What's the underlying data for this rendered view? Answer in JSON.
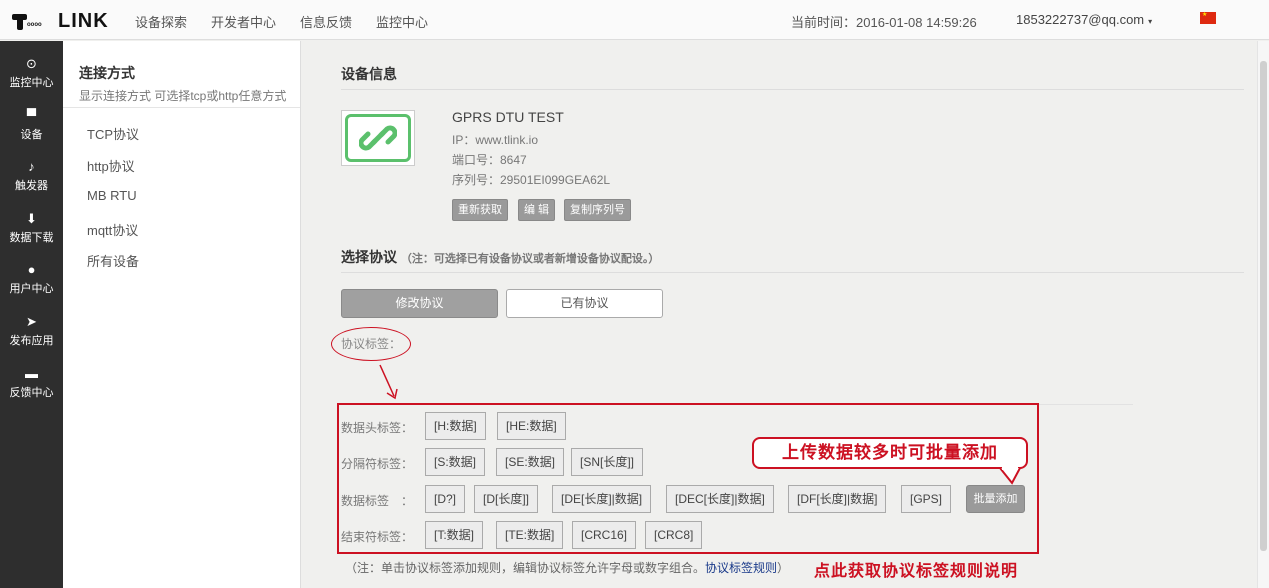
{
  "header": {
    "logo_text": "LINK",
    "logo_dots": "oooo",
    "nav": [
      "设备探索",
      "开发者中心",
      "信息反馈",
      "监控中心"
    ],
    "time_label": "当前时间：2016-01-08 14:59:26",
    "user": "1853222737@qq.com",
    "user_caret": "▾",
    "flag": "★"
  },
  "sidebar": {
    "items": [
      {
        "label": "监控中心",
        "icon": "target-icon",
        "glyph": "⊙"
      },
      {
        "label": "设备",
        "icon": "device-icon",
        "glyph": "▀"
      },
      {
        "label": "触发器",
        "icon": "bell-icon",
        "glyph": "♪"
      },
      {
        "label": "数据下载",
        "icon": "download-icon",
        "glyph": "⬇"
      },
      {
        "label": "用户中心",
        "icon": "user-icon",
        "glyph": "●"
      },
      {
        "label": "发布应用",
        "icon": "send-icon",
        "glyph": "➤"
      },
      {
        "label": "反馈中心",
        "icon": "comment-icon",
        "glyph": "▬"
      }
    ]
  },
  "panel": {
    "title": "连接方式",
    "subtitle": "显示连接方式 可选择tcp或http任意方式",
    "links": [
      "TCP协议",
      "http协议",
      "MB RTU",
      "mqtt协议",
      "所有设备"
    ]
  },
  "device": {
    "section_title": "设备信息",
    "icon": "link-icon",
    "name": "GPRS DTU TEST",
    "ip": "IP：www.tlink.io",
    "port": "端口号：8647",
    "serial": "序列号：29501EI099GEA62L",
    "buttons": [
      "重新获取",
      "编 辑",
      "复制序列号"
    ]
  },
  "protocol": {
    "section_title": "选择协议",
    "section_note": "（注：可选择已有设备协议或者新增设备协议配设。）",
    "tabs": [
      "修改协议",
      "已有协议"
    ],
    "label_tag": "协议标签：",
    "arrow": "↓",
    "rows": [
      {
        "label": "数据头标签：",
        "tags": [
          "[H:数据]",
          "[HE:数据]"
        ]
      },
      {
        "label": "分隔符标签：",
        "tags": [
          "[S:数据]",
          "[SE:数据]",
          "[SN[长度]]"
        ]
      },
      {
        "label": "数据标签　：",
        "tags": [
          "[D?]",
          "[D[长度]]",
          "[DE[长度]|数据]",
          "[DEC[长度]|数据]",
          "[DF[长度]|数据]",
          "[GPS]"
        ]
      },
      {
        "label": "结束符标签：",
        "tags": [
          "[T:数据]",
          "[TE:数据]",
          "[CRC16]",
          "[CRC8]"
        ]
      }
    ],
    "batch_button": "批量添加",
    "callout": "上传数据较多时可批量添加",
    "bottom_note_prefix": "（注：单击协议标签添加规则，编辑协议标签允许字母或数字组合。",
    "bottom_note_link": "协议标签规则",
    "bottom_note_suffix": "）",
    "bottom_red": "点此获取协议标签规则说明"
  }
}
